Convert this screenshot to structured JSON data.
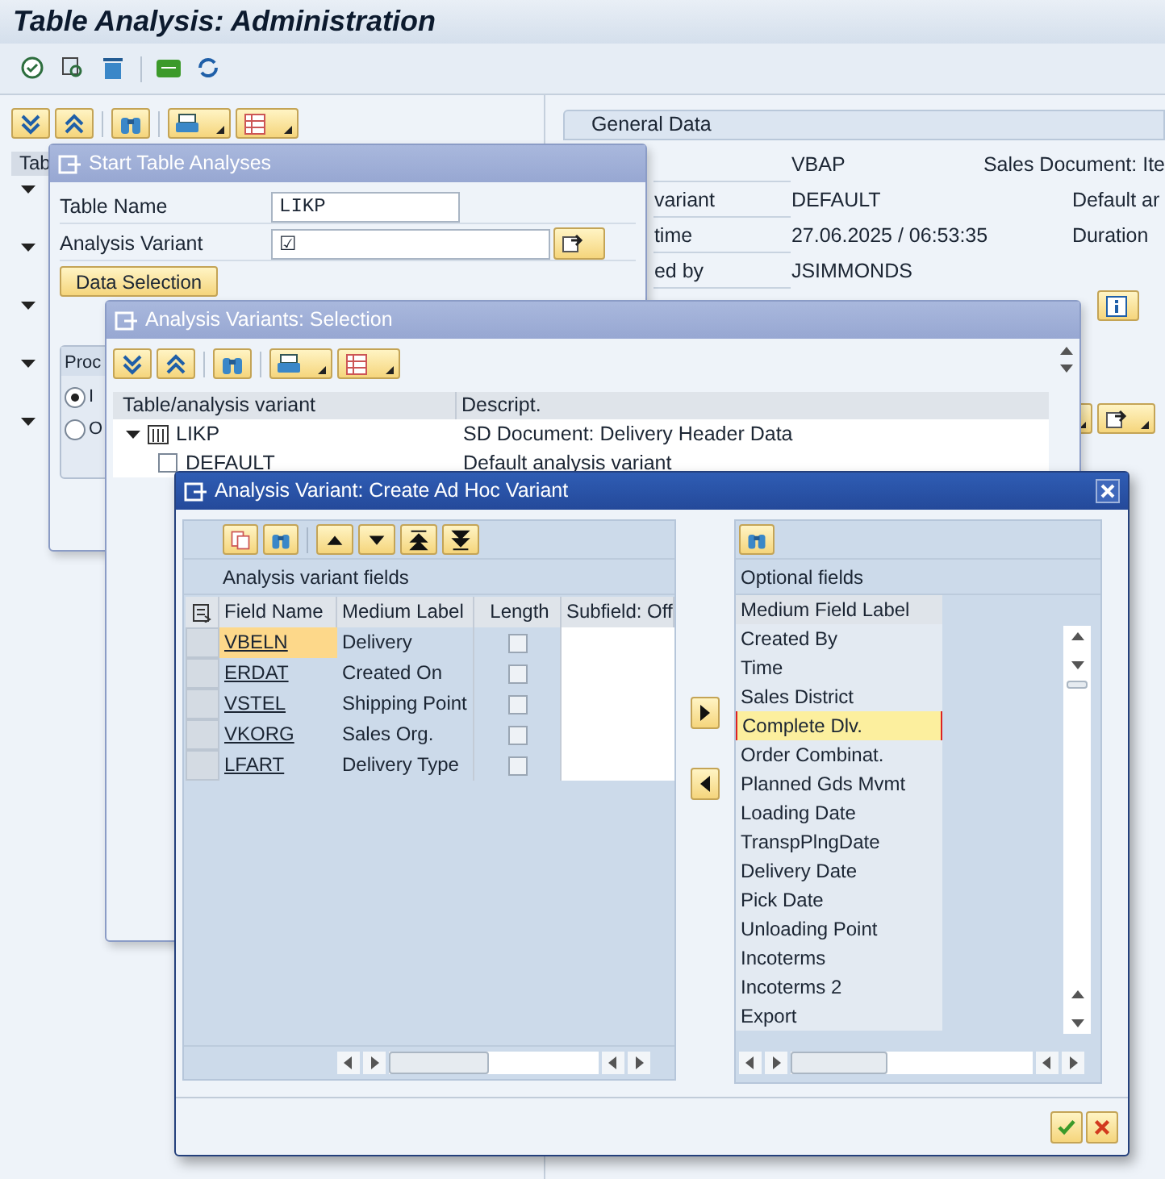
{
  "window": {
    "title": "Table Analysis: Administration"
  },
  "tree": {
    "header": "Tab",
    "rows": [
      {
        "expanded": true
      },
      {
        "expanded": true
      },
      {
        "expanded": true
      },
      {
        "expanded": true
      },
      {
        "expanded": true
      }
    ]
  },
  "general_data": {
    "title": "General Data",
    "rows": [
      {
        "label": "",
        "value": "VBAP",
        "description": "Sales Document: Ite"
      },
      {
        "label": "variant",
        "value": "DEFAULT",
        "next_label": "Default ar"
      },
      {
        "label": "time",
        "value": "27.06.2025 / 06:53:35",
        "next_label": "Duration"
      },
      {
        "label": "ed by",
        "value": "JSIMMONDS"
      }
    ]
  },
  "start_dialog": {
    "title": "Start Table Analyses",
    "fields": [
      {
        "label": "Table Name",
        "value": "LIKP",
        "kind": "text"
      },
      {
        "label": "Analysis Variant",
        "value": "☑",
        "kind": "lookup"
      }
    ],
    "button": "Data Selection",
    "group": {
      "title": "Proc",
      "options": [
        {
          "label": "I",
          "selected": true
        },
        {
          "label": "O",
          "selected": false
        }
      ]
    }
  },
  "selection_dialog": {
    "title": "Analysis Variants: Selection",
    "columns": [
      "Table/analysis variant",
      "Descript."
    ],
    "rows": [
      {
        "name": "LIKP",
        "description": "SD Document: Delivery Header Data",
        "expanded": true,
        "children": [
          {
            "name": "DEFAULT",
            "description": "Default analysis variant",
            "checked": false
          }
        ]
      }
    ]
  },
  "adhoc_dialog": {
    "title": "Analysis Variant: Create Ad Hoc Variant",
    "variant_fields": {
      "title": "Analysis variant fields",
      "columns": [
        "Field Name",
        "Medium Label",
        "Length",
        "Subfield: Off"
      ],
      "rows": [
        {
          "field": "VBELN",
          "label": "Delivery",
          "length": false,
          "selected": true
        },
        {
          "field": "ERDAT",
          "label": "Created On",
          "length": false,
          "selected": false
        },
        {
          "field": "VSTEL",
          "label": "Shipping Point",
          "length": false,
          "selected": false
        },
        {
          "field": "VKORG",
          "label": "Sales Org.",
          "length": false,
          "selected": false
        },
        {
          "field": "LFART",
          "label": "Delivery Type",
          "length": false,
          "selected": false
        }
      ]
    },
    "optional_fields": {
      "title": "Optional fields",
      "column": "Medium Field Label",
      "items": [
        {
          "label": "Created By",
          "selected": false
        },
        {
          "label": "Time",
          "selected": false
        },
        {
          "label": "Sales District",
          "selected": false
        },
        {
          "label": "Complete Dlv.",
          "selected": true
        },
        {
          "label": "Order Combinat.",
          "selected": false
        },
        {
          "label": "Planned Gds Mvmt",
          "selected": false
        },
        {
          "label": "Loading Date",
          "selected": false
        },
        {
          "label": "TranspPlngDate",
          "selected": false
        },
        {
          "label": "Delivery Date",
          "selected": false
        },
        {
          "label": "Pick Date",
          "selected": false
        },
        {
          "label": "Unloading Point",
          "selected": false
        },
        {
          "label": "Incoterms",
          "selected": false
        },
        {
          "label": "Incoterms 2",
          "selected": false
        },
        {
          "label": "Export",
          "selected": false
        }
      ]
    }
  }
}
